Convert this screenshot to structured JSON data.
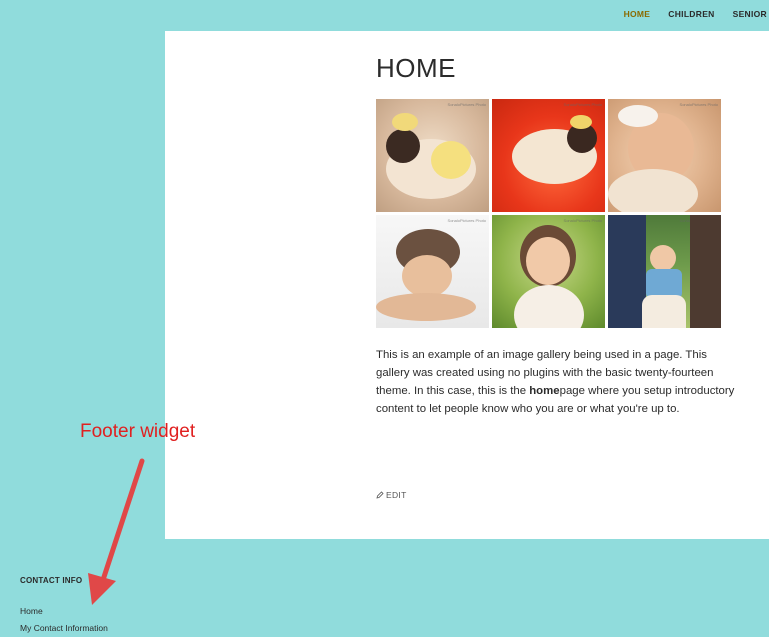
{
  "nav": {
    "items": [
      {
        "label": "HOME",
        "active": true
      },
      {
        "label": "CHILDREN",
        "active": false
      },
      {
        "label": "SENIOR",
        "active": false
      }
    ],
    "active_color": "#8a6a00"
  },
  "page": {
    "title": "HOME",
    "gallery": {
      "watermark": "SonaloPictures Photo",
      "images": [
        {
          "subject": "newborn with yellow bow on beige blanket"
        },
        {
          "subject": "newborn on red rug"
        },
        {
          "subject": "sleeping newborn with white headband"
        },
        {
          "subject": "baby in knit puppy hat"
        },
        {
          "subject": "smiling toddler girl outdoors"
        },
        {
          "subject": "baby girl held by parents"
        }
      ]
    },
    "body": {
      "part1": "This is an example of an image gallery being used in a page.  This gallery was created using no plugins with the basic twenty-fourteen theme. In this case, this is the ",
      "bold": "home",
      "part2": "page where you setup introductory content to let people know who you are or what you're up to."
    },
    "edit_label": "EDIT"
  },
  "annotation": {
    "label": "Footer widget",
    "color": "#e02020"
  },
  "footer_widget": {
    "title": "CONTACT INFO",
    "links": [
      "Home",
      "My Contact Information"
    ]
  },
  "colors": {
    "background": "#90dcdc",
    "panel": "#ffffff",
    "text": "#2b2b2b"
  }
}
